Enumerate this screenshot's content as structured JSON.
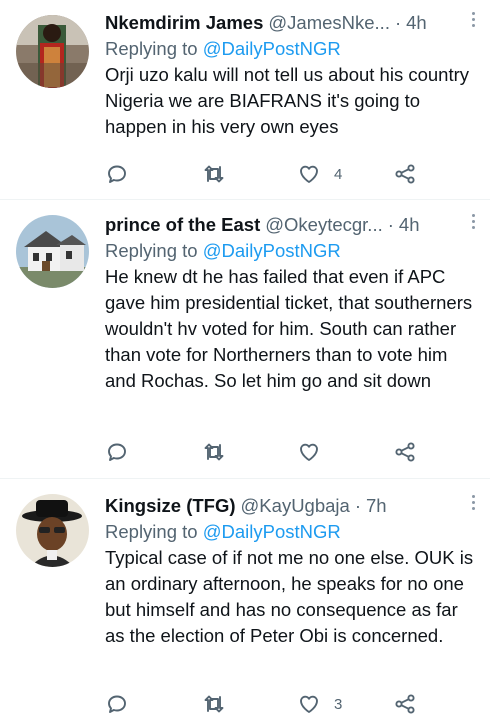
{
  "tweets": [
    {
      "name": "Nkemdirim James",
      "handle": "@JamesNke...",
      "separator": "·",
      "time": "4h",
      "replying_prefix": "Replying to ",
      "replying_to": "@DailyPostNGR",
      "text": "Orji uzo kalu will not tell us about his country Nigeria we are BIAFRANS it's going to happen in his very own eyes",
      "likes": "4"
    },
    {
      "name": "prince of the East",
      "handle": "@Okeytecgr...",
      "separator": "·",
      "time": "4h",
      "replying_prefix": "Replying to ",
      "replying_to": "@DailyPostNGR",
      "text": "He knew dt he has failed that even if APC gave him presidential ticket, that southerners wouldn't hv voted for him. South can rather than vote for Northerners than to vote him and Rochas. So let him go and sit down",
      "likes": ""
    },
    {
      "name": "Kingsize (TFG)",
      "handle": "@KayUgbaja",
      "separator": "·",
      "time": "7h",
      "replying_prefix": "Replying to ",
      "replying_to": "@DailyPostNGR",
      "text": "Typical case of if not me no one else. OUK is an ordinary afternoon, he speaks for no one but himself and has no consequence as far as the election of Peter Obi is concerned.",
      "likes": "3"
    }
  ],
  "icons": [
    "reply-icon",
    "retweet-icon",
    "like-icon",
    "share-icon",
    "more-options-icon"
  ],
  "colors": {
    "link": "#1d9bf0",
    "secondary": "#536471",
    "text": "#0f1419",
    "divider": "#eff3f4"
  }
}
